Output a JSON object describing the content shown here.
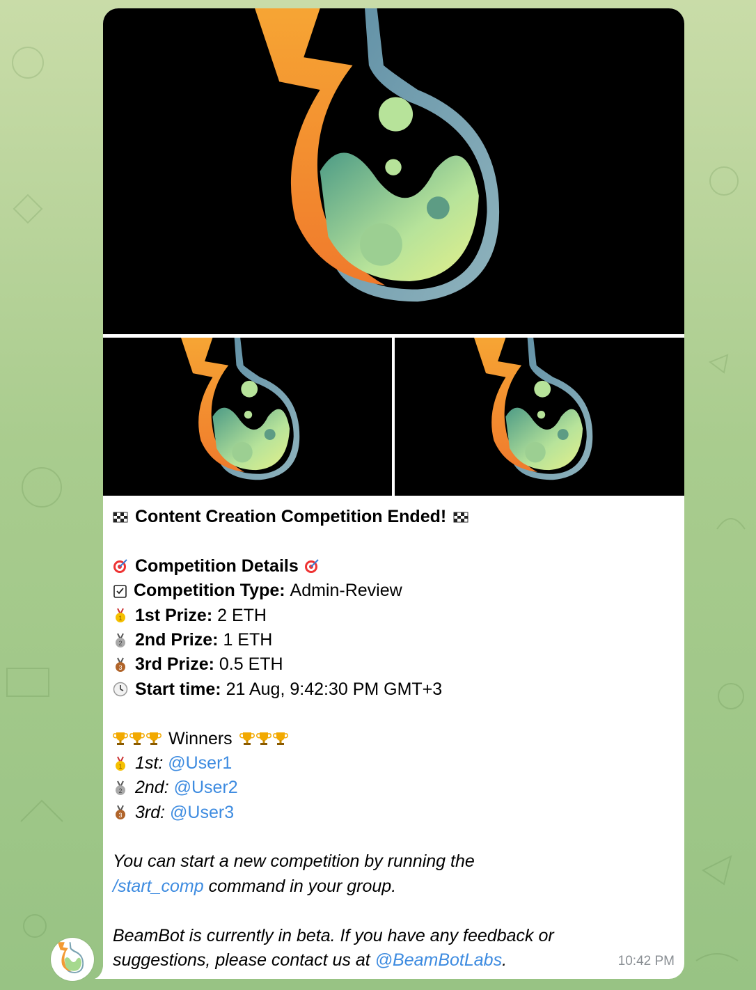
{
  "message": {
    "title": "Content Creation Competition Ended!",
    "details_heading": "Competition Details",
    "type_label": "Competition Type:",
    "type_value": "Admin-Review",
    "prize1_label": "1st Prize:",
    "prize1_value": "2 ETH",
    "prize2_label": "2nd Prize:",
    "prize2_value": "1 ETH",
    "prize3_label": "3rd Prize:",
    "prize3_value": "0.5 ETH",
    "start_label": "Start time:",
    "start_value": "21 Aug, 9:42:30 PM GMT+3",
    "winners_heading": "Winners",
    "winner1_place": "1st:",
    "winner1_user": "@User1",
    "winner2_place": "2nd:",
    "winner2_user": "@User2",
    "winner3_place": "3rd:",
    "winner3_user": "@User3",
    "footer1_a": "You can start a new competition by running the",
    "footer1_cmd": "/start_comp",
    "footer1_b": "command in your group.",
    "footer2_a": "BeamBot is currently in beta. If you have any feedback or suggestions, please contact us at",
    "footer2_link": "@BeamBotLabs",
    "footer2_b": ".",
    "time": "10:42 PM"
  },
  "icons": [
    "checkered-flag-icon",
    "direct-hit-icon",
    "check-box-icon",
    "gold-medal-icon",
    "silver-medal-icon",
    "bronze-medal-icon",
    "clock-icon",
    "trophy-icon"
  ],
  "colors": {
    "link": "#3d8be0",
    "timestamp": "#8a8f94",
    "bubble": "#ffffff"
  }
}
